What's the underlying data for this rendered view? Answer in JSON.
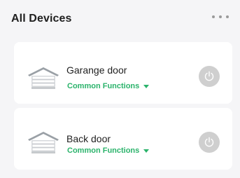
{
  "header": {
    "title": "All Devices",
    "more_icon": "more-horizontal-icon"
  },
  "devices": [
    {
      "name": "Garange door",
      "functions_label": "Common Functions",
      "icon": "garage-door-icon",
      "power_icon": "power-icon",
      "power_state": "off"
    },
    {
      "name": "Back door",
      "functions_label": "Common Functions",
      "icon": "garage-door-icon",
      "power_icon": "power-icon",
      "power_state": "off"
    }
  ],
  "colors": {
    "accent": "#2bb36b",
    "power_off": "#cfcfcf",
    "background": "#f5f5f7",
    "card": "#ffffff"
  }
}
